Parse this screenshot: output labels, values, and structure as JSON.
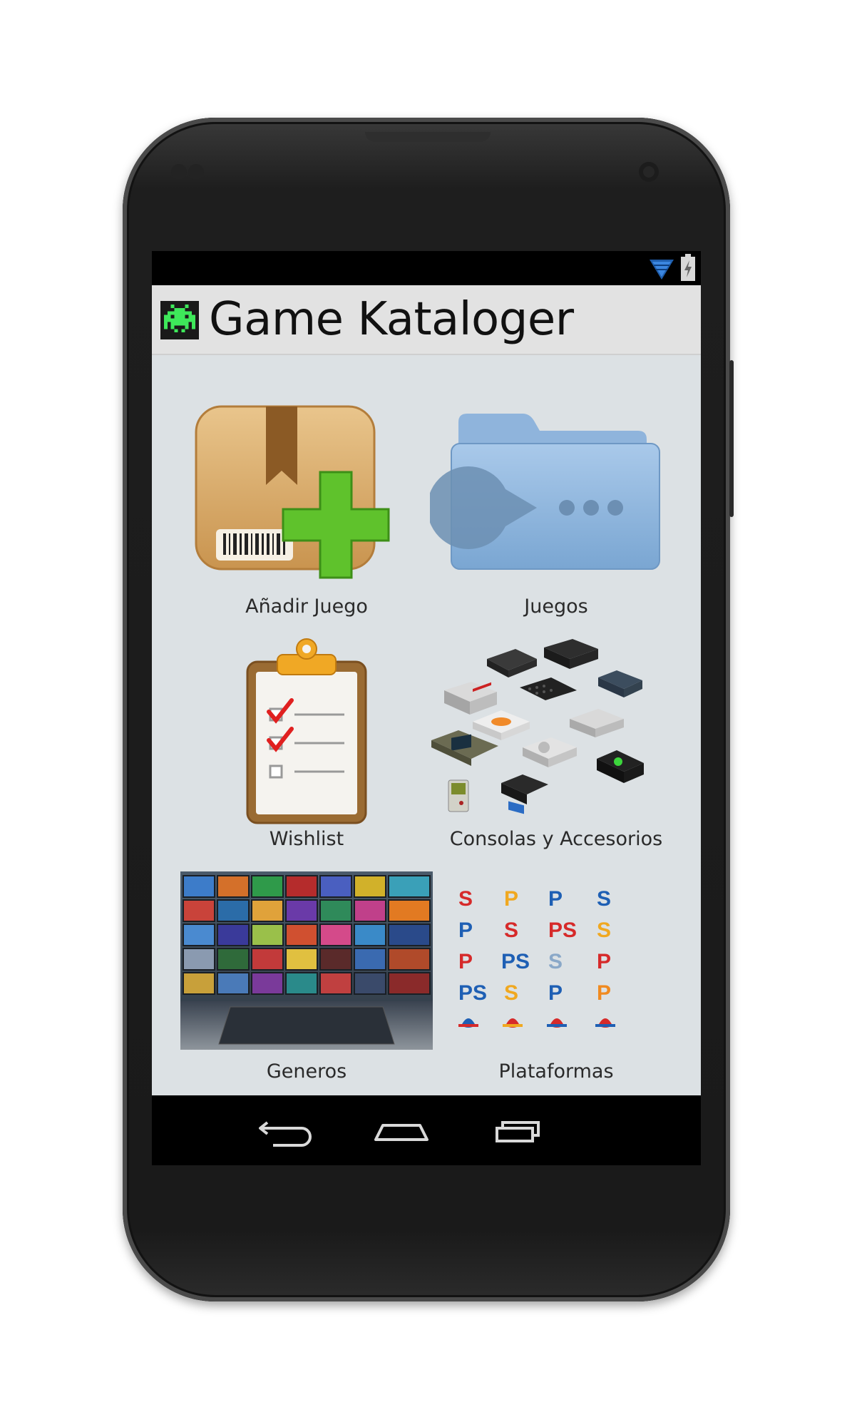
{
  "app": {
    "title": "Game Kataloger",
    "icon": "space-invader-icon"
  },
  "status_bar": {
    "icons": [
      "wifi-icon",
      "battery-charging-icon"
    ]
  },
  "menu": [
    {
      "label": "Añadir Juego",
      "icon": "package-add-icon"
    },
    {
      "label": "Juegos",
      "icon": "pacman-folder-icon"
    },
    {
      "label": "Wishlist",
      "icon": "clipboard-checklist-icon"
    },
    {
      "label": "Consolas y Accesorios",
      "icon": "consoles-collage-icon"
    },
    {
      "label": "Generos",
      "icon": "game-screens-wall-icon"
    },
    {
      "label": "Plataformas",
      "icon": "platform-logos-icon"
    }
  ],
  "nav_bar": {
    "buttons": [
      "back-icon",
      "home-icon",
      "recents-icon"
    ]
  },
  "colors": {
    "content_bg": "#dce1e4",
    "action_bar_bg": "#e2e2e2",
    "phone_body": "#1c1c1c"
  }
}
